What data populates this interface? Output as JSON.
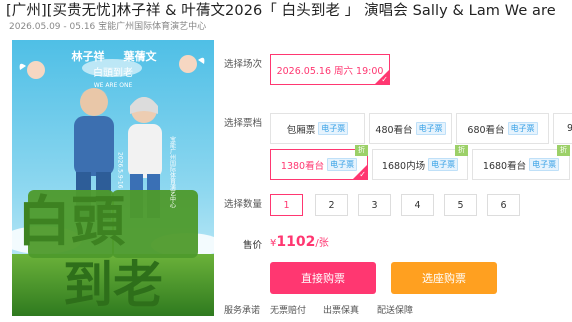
{
  "header": {
    "title": "[广州][买贵无忧]林子祥 & 叶蒨文2026「 白头到老 」 演唱会 Sally & Lam We are",
    "subtitle": "2026.05.09 - 05.16 宝能广州国际体育演艺中心"
  },
  "poster": {
    "name_left": "林子祥",
    "name_right": "葉蒨文",
    "slogan": "白頭到老",
    "slogan_en": "WE ARE ONE",
    "side_dates": "2026.5.9-16",
    "side_venue": "宝能广州国际体育演艺中心",
    "big_text_line1": "白頭",
    "big_text_line2": "到老"
  },
  "session": {
    "label": "选择场次",
    "option": "2026.05.16 周六 19:00"
  },
  "tickets": {
    "label": "选择票档",
    "etag": "电子票",
    "badge": "折",
    "row1": [
      {
        "name": "包厢票"
      },
      {
        "name": "480看台"
      },
      {
        "name": "680看台"
      },
      {
        "name": "9"
      }
    ],
    "row2": [
      {
        "name": "1380看台"
      },
      {
        "name": "1680内场"
      },
      {
        "name": "1680看台"
      }
    ]
  },
  "quantity": {
    "label": "选择数量",
    "options": [
      "1",
      "2",
      "3",
      "4",
      "5",
      "6"
    ]
  },
  "price": {
    "label": "售价",
    "symbol": "¥",
    "value": "1102",
    "unit": "/张"
  },
  "buttons": {
    "buy_direct": "直接购票",
    "buy_seat": "选座购票"
  },
  "service": {
    "label": "服务承诺",
    "items": [
      "无票赔付",
      "出票保真",
      "配送保障"
    ]
  },
  "colors": {
    "accent": "#ff3771",
    "orange": "#ffa020",
    "tag_blue": "#3aa2e6",
    "badge_green": "#9cd068"
  }
}
